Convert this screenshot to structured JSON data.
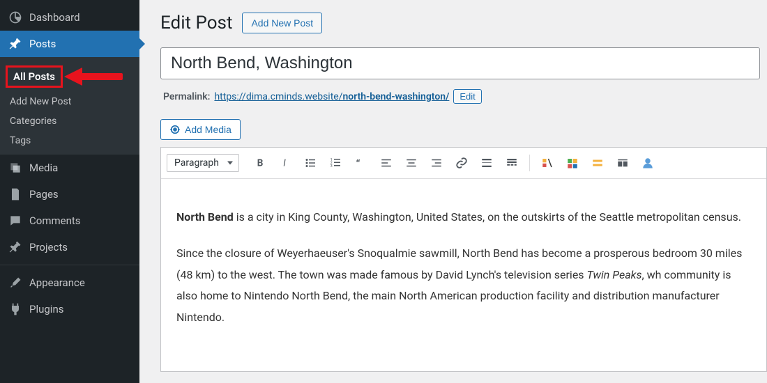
{
  "sidebar": {
    "dashboard": "Dashboard",
    "posts": "Posts",
    "sub": {
      "all_posts": "All Posts",
      "add_new": "Add New Post",
      "categories": "Categories",
      "tags": "Tags"
    },
    "media": "Media",
    "pages": "Pages",
    "comments": "Comments",
    "projects": "Projects",
    "appearance": "Appearance",
    "plugins": "Plugins"
  },
  "main": {
    "heading": "Edit Post",
    "add_new_btn": "Add New Post",
    "title_value": "North Bend, Washington",
    "permalink_label": "Permalink:",
    "permalink_base": "https://dima.cminds.website/",
    "permalink_slug": "north-bend-washington/",
    "permalink_edit": "Edit",
    "add_media_btn": "Add Media",
    "format_select": "Paragraph"
  },
  "content": {
    "p1_bold": "North Bend",
    "p1_rest": " is a city in King County, Washington, United States, on the outskirts of the Seattle metropolitan census.",
    "p2a": "Since the closure of Weyerhaeuser's Snoqualmie sawmill, North Bend has become a prosperous bedroom 30 miles (48 km) to the west. The town was made famous by David Lynch's television series ",
    "p2_italic": "Twin Peaks",
    "p2b": ", wh community is also home to Nintendo North Bend, the main North American production facility and distribution manufacturer Nintendo."
  }
}
